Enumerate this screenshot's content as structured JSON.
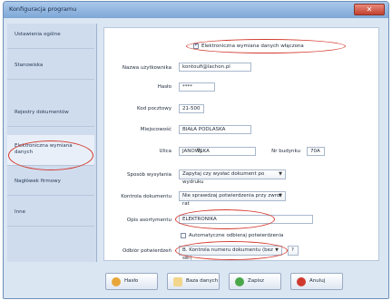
{
  "window": {
    "title": "Konfiguracja programu",
    "close_glyph": "✕"
  },
  "sidebar": {
    "items": [
      {
        "label": "Ustawienia ogólne"
      },
      {
        "label": "Stanowiska"
      },
      {
        "label": "Rejestry dokumentów"
      },
      {
        "label": "Elektroniczna wymiana danych"
      },
      {
        "label": "Nagłówek firmowy"
      },
      {
        "label": "Inne"
      }
    ]
  },
  "form": {
    "edi_enabled_label": "Elektroniczna wymiana danych włączona",
    "edi_enabled_checked": "✓",
    "user_label": "Nazwa użytkownika",
    "user_value": "kontoufi@lachon.pl",
    "password_label": "Hasło",
    "password_value": "****",
    "postal_label": "Kod pocztowy",
    "postal_value": "21-500",
    "city_label": "Miejscowość",
    "city_value": "BIAŁA PODLASKA",
    "street_label": "Ulica",
    "street_value": "JANOWSKA",
    "building_label": "Nr budynku",
    "building_value": "70A",
    "send_mode_label": "Sposób wysyłania",
    "send_mode_value": "Zapytaj czy wysłać dokument po wydruku",
    "control_label": "Kontrola dokumentu",
    "control_value": "Nie sprawdzaj potwierdzenia przy zwrot rat",
    "assortment_label": "Opis asortymentu",
    "assortment_value": "ELEKTRONIKA",
    "auto_receive_label": "Automatyczne odbieraj potwierdzenia",
    "receive_label": "Odbiór potwierdzeń",
    "receive_value": "B. Kontrola numeru dokumentu (bez ser)",
    "receive_extra": "?"
  },
  "buttons": {
    "help": "Hasło",
    "database": "Baza danych",
    "save": "Zapisz",
    "close": "Anuluj"
  },
  "colors": {
    "accent_ring": "#d33a2e",
    "titlebar": "#7ea7d6",
    "close_button": "#c2412e"
  }
}
